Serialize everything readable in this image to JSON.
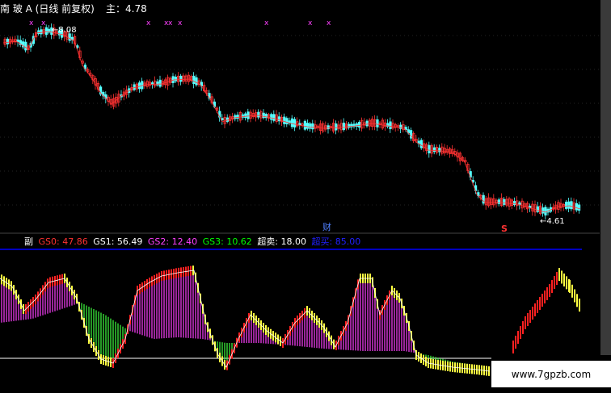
{
  "header": {
    "stock_title": "南 玻 A (日线 前复权)",
    "main_label": "主：4.78"
  },
  "main_chart": {
    "high_label": "8.08",
    "low_label": "4.61",
    "event_marker": "财",
    "s_marker": "S",
    "top_markers": [
      "x",
      "x",
      "x",
      "xx",
      "x",
      "x",
      "x",
      "x"
    ]
  },
  "indicator_header": {
    "label": "副",
    "gs0": "GS0: 47.86",
    "gs1": "GS1: 56.49",
    "gs2": "GS2: 12.40",
    "gs3": "GS3: 10.62",
    "oversell": "超卖: 18.00",
    "overbuy": "超买: 85.00"
  },
  "watermark": "www.7gpzb.com",
  "colors": {
    "up_candle": "#ff3232",
    "down_candle": "#54ffff",
    "gs0": "#ff3232",
    "gs1": "#ffffff",
    "gs2": "#ff40ff",
    "gs3": "#00ff00",
    "overbuy_line": "#0000ff",
    "oversell_line": "#ffffff",
    "bar_red": "#ff2020",
    "bar_yellow": "#ffff40",
    "band_green": "#40ff40",
    "band_magenta": "#ff40ff"
  }
}
